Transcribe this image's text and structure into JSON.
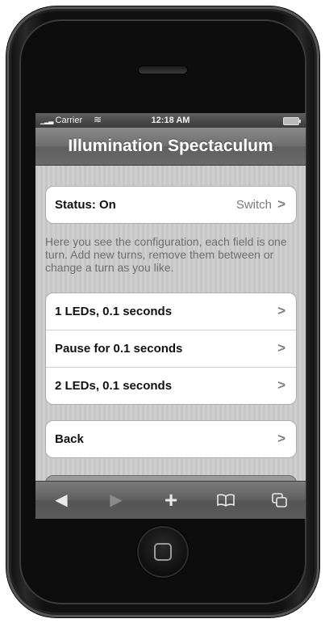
{
  "status_bar": {
    "carrier": "Carrier",
    "time": "12:18 AM"
  },
  "navbar": {
    "title": "Illumination Spectaculum"
  },
  "status_row": {
    "label": "Status: On",
    "action": "Switch",
    "chevron": ">"
  },
  "info_text": "Here you see the configuration, each field is one turn. Add new turns, remove them between or change a turn as you like.",
  "turns": [
    {
      "label": "1 LEDs, 0.1 seconds",
      "chevron": ">"
    },
    {
      "label": "Pause for 0.1 seconds",
      "chevron": ">"
    },
    {
      "label": "2 LEDs, 0.1 seconds",
      "chevron": ">"
    }
  ],
  "back_row": {
    "label": "Back",
    "chevron": ">"
  },
  "toolbar": {
    "back_icon": "◀",
    "forward_icon": "▶",
    "add_icon": "+",
    "bookmarks_icon": "bookmarks-icon",
    "pages_icon": "pages-icon"
  },
  "colors": {
    "bar_gray": "#6d6d6d",
    "content_stripe": "#c6c6c6",
    "cell_white": "#ffffff",
    "label_dark": "#111111",
    "secondary_text": "#7a7a7a"
  }
}
